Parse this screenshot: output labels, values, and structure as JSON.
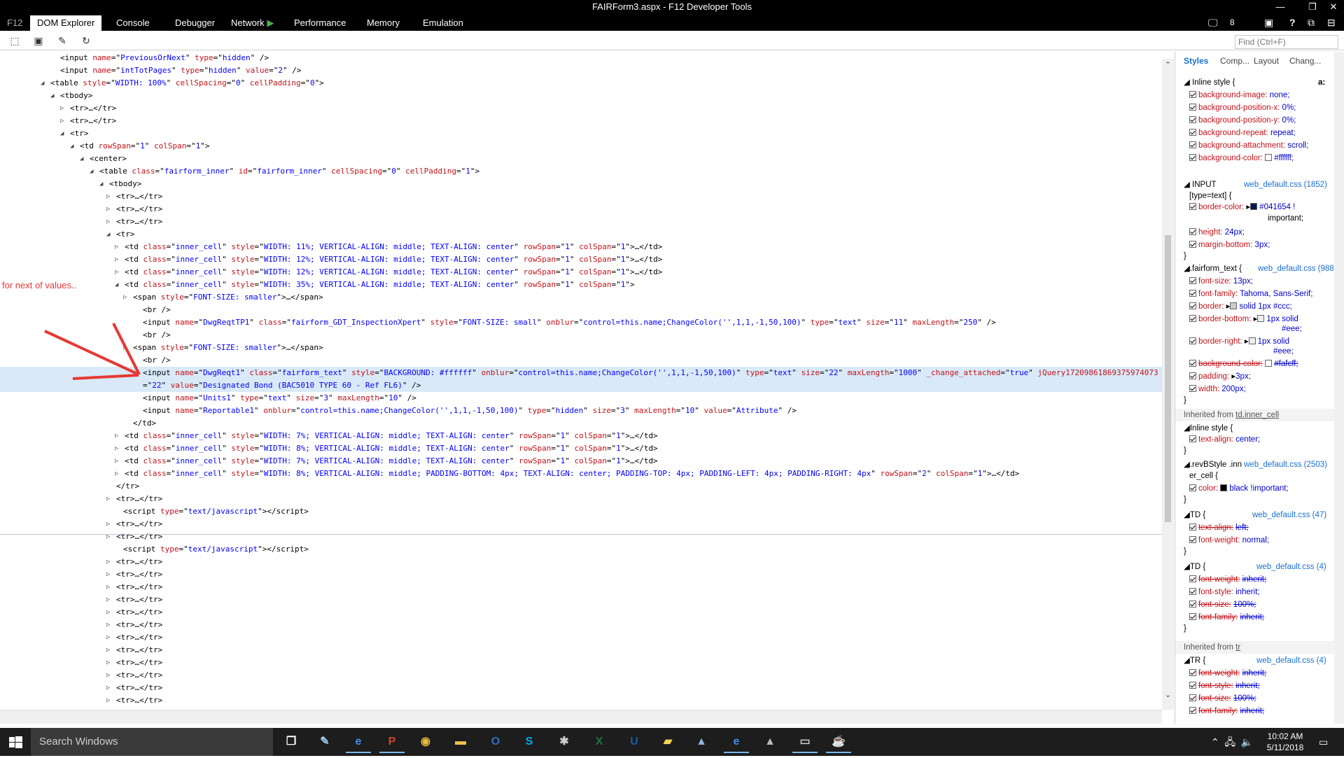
{
  "window": {
    "title": "FAIRForm3.aspx - F12 Developer Tools"
  },
  "tabs": [
    {
      "label": "F12"
    },
    {
      "label": "DOM Explorer"
    },
    {
      "label": "Console"
    },
    {
      "label": "Debugger"
    },
    {
      "label": "Network"
    },
    {
      "label": "Performance"
    },
    {
      "label": "Memory"
    },
    {
      "label": "Emulation"
    }
  ],
  "tab_extras": {
    "screen_count": "8",
    "help": "?"
  },
  "find": {
    "placeholder": "Find (Ctrl+F)"
  },
  "annotation": {
    "text": "for next of values..",
    "color": "#e53935"
  },
  "dom_lines": [
    {
      "html": "<span class='tag'>&lt;input </span><span class='an'>name</span>=\"<span class='av'>PreviousOrNext</span>\" <span class='an'>type</span>=\"<span class='av'>hidden</span>\" /&gt;"
    },
    {
      "html": "<span class='tag'>&lt;input </span><span class='an'>name</span>=\"<span class='av'>intTotPages</span>\" <span class='an'>type</span>=\"<span class='av'>hidden</span>\" <span class='an'>value</span>=\"<span class='av'>2</span>\" /&gt;"
    },
    {
      "html": "&lt;table <span class='an'>style</span>=\"<span class='av'>WIDTH: 100%</span>\" <span class='an'>cellSpacing</span>=\"<span class='av'>0</span>\" <span class='an'>cellPadding</span>=\"<span class='av'>0</span>\"&gt;"
    },
    {
      "html": "&lt;tbody&gt;"
    },
    {
      "html": "&lt;tr&gt;…&lt;/tr&gt;"
    },
    {
      "html": "&lt;tr&gt;…&lt;/tr&gt;"
    },
    {
      "html": "&lt;tr&gt;"
    },
    {
      "html": "&lt;td <span class='an'>rowSpan</span>=\"<span class='av'>1</span>\" <span class='an'>colSpan</span>=\"<span class='av'>1</span>\"&gt;"
    },
    {
      "html": "&lt;center&gt;"
    },
    {
      "html": "&lt;table <span class='an'>class</span>=\"<span class='av'>fairform_inner</span>\" <span class='an'>id</span>=\"<span class='av'>fairform_inner</span>\" <span class='an'>cellSpacing</span>=\"<span class='av'>0</span>\" <span class='an'>cellPadding</span>=\"<span class='av'>1</span>\"&gt;"
    },
    {
      "html": "&lt;tbody&gt;"
    },
    {
      "html": "&lt;tr&gt;…&lt;/tr&gt;"
    },
    {
      "html": "&lt;tr&gt;…&lt;/tr&gt;"
    },
    {
      "html": "&lt;tr&gt;…&lt;/tr&gt;"
    },
    {
      "html": "&lt;tr&gt;"
    },
    {
      "html": "&lt;td <span class='an'>class</span>=\"<span class='av'>inner_cell</span>\" <span class='an'>style</span>=\"<span class='av'>WIDTH: 11%; VERTICAL-ALIGN: middle; TEXT-ALIGN: center</span>\" <span class='an'>rowSpan</span>=\"<span class='av'>1</span>\" <span class='an'>colSpan</span>=\"<span class='av'>1</span>\"&gt;…&lt;/td&gt;"
    },
    {
      "html": "&lt;td <span class='an'>class</span>=\"<span class='av'>inner_cell</span>\" <span class='an'>style</span>=\"<span class='av'>WIDTH: 12%; VERTICAL-ALIGN: middle; TEXT-ALIGN: center</span>\" <span class='an'>rowSpan</span>=\"<span class='av'>1</span>\" <span class='an'>colSpan</span>=\"<span class='av'>1</span>\"&gt;…&lt;/td&gt;"
    },
    {
      "html": "&lt;td <span class='an'>class</span>=\"<span class='av'>inner_cell</span>\" <span class='an'>style</span>=\"<span class='av'>WIDTH: 12%; VERTICAL-ALIGN: middle; TEXT-ALIGN: center</span>\" <span class='an'>rowSpan</span>=\"<span class='av'>1</span>\" <span class='an'>colSpan</span>=\"<span class='av'>1</span>\"&gt;…&lt;/td&gt;"
    },
    {
      "html": "&lt;td <span class='an'>class</span>=\"<span class='av'>inner_cell</span>\" <span class='an'>style</span>=\"<span class='av'>WIDTH: 35%; VERTICAL-ALIGN: middle; TEXT-ALIGN: center</span>\" <span class='an'>rowSpan</span>=\"<span class='av'>1</span>\" <span class='an'>colSpan</span>=\"<span class='av'>1</span>\"&gt;"
    },
    {
      "html": "&lt;span <span class='an'>style</span>=\"<span class='av'>FONT-SIZE: smaller</span>\"&gt;…&lt;/span&gt;"
    },
    {
      "html": "&lt;br /&gt;"
    },
    {
      "html": "&lt;input <span class='an'>name</span>=\"<span class='av'>DwgReqtTP1</span>\" <span class='an'>class</span>=\"<span class='av'>fairform_GDT_InspectionXpert</span>\" <span class='an'>style</span>=\"<span class='av'>FONT-SIZE: small</span>\" <span class='an'>onblur</span>=\"<span class='av'>control=this.name;ChangeColor('',1,1,-1,50,100)</span>\" <span class='an'>type</span>=\"<span class='av'>text</span>\" <span class='an'>size</span>=\"<span class='av'>11</span>\" <span class='an'>maxLength</span>=\"<span class='av'>250</span>\" /&gt;"
    },
    {
      "html": "&lt;br /&gt;"
    },
    {
      "html": "&lt;span <span class='an'>style</span>=\"<span class='av'>FONT-SIZE: smaller</span>\"&gt;…&lt;/span&gt;"
    },
    {
      "html": "&lt;br /&gt;"
    },
    {
      "html": "&lt;input <span class='an'>name</span>=\"<span class='av'>DwgReqt1</span>\" <span class='an'>class</span>=\"<span class='av'>fairform_text</span>\" <span class='an'>style</span>=\"<span class='av'>BACKGROUND: #ffffff</span>\" <span class='an'>onblur</span>=\"<span class='av'>control=this.name;ChangeColor('',1,1,-1,50,100)</span>\" <span class='an'>type</span>=\"<span class='av'>text</span>\" <span class='an'>size</span>=\"<span class='av'>22</span>\" <span class='an'>maxLength</span>=\"<span class='av'>1000</span>\" <span class='an'>_change_attached</span>=\"<span class='av'>true</span>\" <span class='an'>jQuery17209861869375974073</span>"
    },
    {
      "html": "=\"<span class='av'>22</span>\" <span class='an'>value</span>=\"<span class='av'>Designated Bond (BAC5010 TYPE 60 - Ref FL6)</span>\" /&gt;"
    },
    {
      "html": "&lt;input <span class='an'>name</span>=\"<span class='av'>Units1</span>\" <span class='an'>type</span>=\"<span class='av'>text</span>\" <span class='an'>size</span>=\"<span class='av'>3</span>\" <span class='an'>maxLength</span>=\"<span class='av'>10</span>\" /&gt;"
    },
    {
      "html": "&lt;input <span class='an'>name</span>=\"<span class='av'>Reportable1</span>\" <span class='an'>onblur</span>=\"<span class='av'>control=this.name;ChangeColor('',1,1,-1,50,100)</span>\" <span class='an'>type</span>=\"<span class='av'>hidden</span>\" <span class='an'>size</span>=\"<span class='av'>3</span>\" <span class='an'>maxLength</span>=\"<span class='av'>10</span>\" <span class='an'>value</span>=\"<span class='av'>Attribute</span>\" /&gt;"
    },
    {
      "html": "&lt;/td&gt;"
    },
    {
      "html": "&lt;td <span class='an'>class</span>=\"<span class='av'>inner_cell</span>\" <span class='an'>style</span>=\"<span class='av'>WIDTH: 7%; VERTICAL-ALIGN: middle; TEXT-ALIGN: center</span>\" <span class='an'>rowSpan</span>=\"<span class='av'>1</span>\" <span class='an'>colSpan</span>=\"<span class='av'>1</span>\"&gt;…&lt;/td&gt;"
    },
    {
      "html": "&lt;td <span class='an'>class</span>=\"<span class='av'>inner_cell</span>\" <span class='an'>style</span>=\"<span class='av'>WIDTH: 8%; VERTICAL-ALIGN: middle; TEXT-ALIGN: center</span>\" <span class='an'>rowSpan</span>=\"<span class='av'>1</span>\" <span class='an'>colSpan</span>=\"<span class='av'>1</span>\"&gt;…&lt;/td&gt;"
    },
    {
      "html": "&lt;td <span class='an'>class</span>=\"<span class='av'>inner_cell</span>\" <span class='an'>style</span>=\"<span class='av'>WIDTH: 7%; VERTICAL-ALIGN: middle; TEXT-ALIGN: center</span>\" <span class='an'>rowSpan</span>=\"<span class='av'>1</span>\" <span class='an'>colSpan</span>=\"<span class='av'>1</span>\"&gt;…&lt;/td&gt;"
    },
    {
      "html": "&lt;td <span class='an'>class</span>=\"<span class='av'>inner_cell</span>\" <span class='an'>style</span>=\"<span class='av'>WIDTH: 8%; VERTICAL-ALIGN: middle; PADDING-BOTTOM: 4px; TEXT-ALIGN: center; PADDING-TOP: 4px; PADDING-LEFT: 4px; PADDING-RIGHT: 4px</span>\" <span class='an'>rowSpan</span>=\"<span class='av'>2</span>\" <span class='an'>colSpan</span>=\"<span class='av'>1</span>\"&gt;…&lt;/td&gt;"
    },
    {
      "html": "&lt;/tr&gt;"
    },
    {
      "html": "&lt;tr&gt;…&lt;/tr&gt;"
    },
    {
      "html": "&lt;script <span class='an'>type</span>=\"<span class='av'>text/javascript</span>\"&gt;&lt;/script&gt;"
    },
    {
      "html": "&lt;tr&gt;…&lt;/tr&gt;"
    },
    {
      "html": "&lt;tr&gt;…&lt;/tr&gt;"
    },
    {
      "html": "&lt;script <span class='an'>type</span>=\"<span class='av'>text/javascript</span>\"&gt;&lt;/script&gt;"
    },
    {
      "html": "&lt;tr&gt;…&lt;/tr&gt;"
    },
    {
      "html": "&lt;tr&gt;…&lt;/tr&gt;"
    },
    {
      "html": "&lt;tr&gt;…&lt;/tr&gt;"
    },
    {
      "html": "&lt;tr&gt;…&lt;/tr&gt;"
    },
    {
      "html": "&lt;tr&gt;…&lt;/tr&gt;"
    },
    {
      "html": "&lt;tr&gt;…&lt;/tr&gt;"
    },
    {
      "html": "&lt;tr&gt;…&lt;/tr&gt;"
    },
    {
      "html": "&lt;tr&gt;…&lt;/tr&gt;"
    },
    {
      "html": "&lt;tr&gt;…&lt;/tr&gt;"
    },
    {
      "html": "&lt;tr&gt;…&lt;/tr&gt;"
    },
    {
      "html": "&lt;tr&gt;…&lt;/tr&gt;"
    },
    {
      "html": "&lt;tr&gt;…&lt;/tr&gt;"
    }
  ],
  "styles_panel": {
    "tabs": [
      "Styles",
      "Comp...",
      "Layout",
      "Chang..."
    ],
    "aa_label": "a:",
    "inline_style": {
      "header": "Inline style  {",
      "props": [
        {
          "name": "background-image:",
          "value": "none;"
        },
        {
          "name": "background-position-x:",
          "value": "0%;"
        },
        {
          "name": "background-position-y:",
          "value": "0%;"
        },
        {
          "name": "background-repeat:",
          "value": "repeat;"
        },
        {
          "name": "background-attachment:",
          "value": "scroll;"
        },
        {
          "name": "background-color:",
          "value": "#ffffff;"
        }
      ]
    },
    "input_rule": {
      "selector": "INPUT",
      "selector2": "[type=text]  {",
      "source": "web_default.css (1852)",
      "border_color_name": "border-color:",
      "border_color_value": "#041654 !",
      "border_color_value2": "important;",
      "height_name": "height:",
      "height_value": "24px;",
      "margin_name": "margin-bottom:",
      "margin_value": "3px;"
    },
    "fairform_rule": {
      "selector": ".fairform_text  {",
      "source": "web_default.css (988)",
      "font_size": {
        "name": "font-size:",
        "value": "13px;"
      },
      "font_family": {
        "name": "font-family:",
        "value": "Tahoma, Sans-Serif;"
      },
      "border": {
        "name": "border:",
        "value": "solid 1px #ccc;"
      },
      "border_bottom": {
        "name": "border-bottom:",
        "value": "1px solid",
        "value2": "#eee;"
      },
      "border_right": {
        "name": "border-right:",
        "value": "1px solid",
        "value2": "#eee;"
      },
      "bg_color": {
        "name": "background-color:",
        "value": "#fafcff;"
      },
      "padding": {
        "name": "padding:",
        "value": "3px;"
      },
      "width": {
        "name": "width:",
        "value": "200px;"
      }
    },
    "inherited_td": {
      "label": "Inherited from ",
      "link": "td.inner_cell"
    },
    "td_inline": {
      "header": "Inline style  {",
      "name": "text-align:",
      "value": "center;"
    },
    "revb_rule": {
      "selector": ".revBStyle .inn",
      "selector2": "er_cell  {",
      "source": "web_default.css (2503)",
      "name": "color:",
      "value": "black !important;"
    },
    "td_rule1": {
      "selector": "TD  {",
      "source": "web_default.css (47)",
      "p1": {
        "name": "text-align:",
        "value": "left;"
      },
      "p2": {
        "name": "font-weight:",
        "value": "normal;"
      }
    },
    "td_rule2": {
      "selector": "TD  {",
      "source": "web_default.css (4)",
      "p1": {
        "name": "font-weight:",
        "value": "inherit;"
      },
      "p2": {
        "name": "font-style:",
        "value": "inherit;"
      },
      "p3": {
        "name": "font-size:",
        "value": "100%;"
      },
      "p4": {
        "name": "font-family:",
        "value": "inherit;"
      }
    },
    "inherited_tr": {
      "label": "Inherited from ",
      "link": "tr"
    },
    "tr_rule": {
      "selector": "TR  {",
      "source": "web_default.css (4)",
      "p1": {
        "name": "font-weight:",
        "value": "inherit;"
      },
      "p2": {
        "name": "font-style:",
        "value": "inherit;"
      },
      "p3": {
        "name": "font-size:",
        "value": "100%;"
      },
      "p4": {
        "name": "font-family:",
        "value": "inherit;"
      }
    },
    "swatch_colors": {
      "white": "#ffffff",
      "navy": "#041654",
      "gray": "#cccccc",
      "light": "#eeeeee",
      "fafcff": "#fafcff",
      "black": "#000000"
    }
  },
  "taskbar": {
    "search_placeholder": "Search Windows",
    "time": "10:02 AM",
    "date": "5/11/2018",
    "apps": [
      {
        "icon": "task-view-icon",
        "glyph": "❐"
      },
      {
        "icon": "notepad-icon",
        "glyph": "✎"
      },
      {
        "icon": "edge-icon",
        "glyph": "e"
      },
      {
        "icon": "powerpoint-icon",
        "glyph": "P"
      },
      {
        "icon": "chrome-icon",
        "glyph": "◉"
      },
      {
        "icon": "file-explorer-icon",
        "glyph": "▬"
      },
      {
        "icon": "outlook-icon",
        "glyph": "O"
      },
      {
        "icon": "skype-icon",
        "glyph": "S"
      },
      {
        "icon": "tool-icon",
        "glyph": "✱"
      },
      {
        "icon": "excel-icon",
        "glyph": "X"
      },
      {
        "icon": "u-app-icon",
        "glyph": "U"
      },
      {
        "icon": "sticky-notes-icon",
        "glyph": "▰"
      },
      {
        "icon": "arrow-app-icon",
        "glyph": "▲"
      },
      {
        "icon": "ie-icon",
        "glyph": "e"
      },
      {
        "icon": "vpn-icon",
        "glyph": "▲"
      },
      {
        "icon": "cmd-icon",
        "glyph": "▭"
      },
      {
        "icon": "java-icon",
        "glyph": "☕"
      }
    ]
  }
}
